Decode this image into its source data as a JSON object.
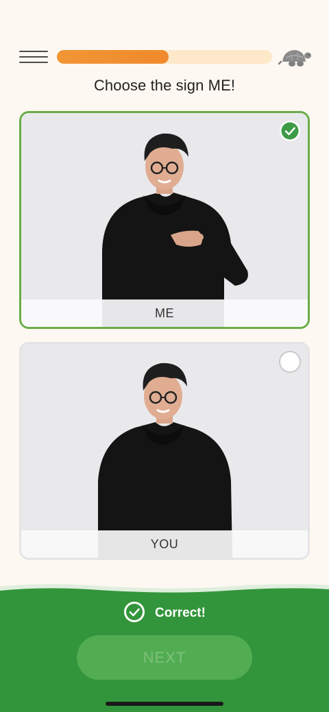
{
  "header": {
    "menu_icon": "hamburger-menu-icon",
    "progress": 0.52,
    "speed_icon": "turtle-icon"
  },
  "prompt": {
    "text": "Choose the sign ME!"
  },
  "options": [
    {
      "label": "ME",
      "state": "selected-correct",
      "status_icon": "check-circle-icon"
    },
    {
      "label": "YOU",
      "state": "unselected",
      "status_icon": "radio-empty-icon"
    }
  ],
  "result": {
    "icon": "check-circle-icon",
    "text": "Correct!",
    "next_label": "NEXT"
  },
  "colors": {
    "background": "#fdf8f1",
    "accent_orange": "#f19535",
    "progress_track": "#fde8c9",
    "correct_green": "#6aac47",
    "panel_green": "#33953b"
  }
}
